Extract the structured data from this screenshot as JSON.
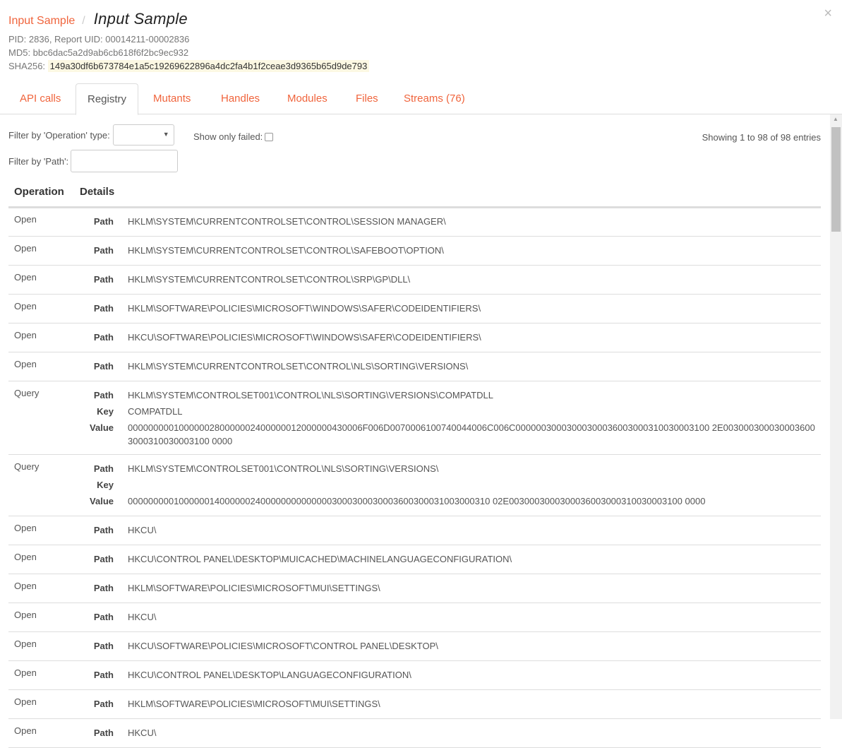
{
  "header": {
    "breadcrumb_link": "Input Sample",
    "breadcrumb_separator": "/",
    "title": "Input Sample",
    "pid_line": "PID: 2836, Report UID: 00014211-00002836",
    "md5_line": "MD5: bbc6dac5a2d9ab6cb618f6f2bc9ec932",
    "sha256_label": "SHA256:",
    "sha256_value": "149a30df6b673784e1a5c19269622896a4dc2fa4b1f2ceae3d9365b65d9de793",
    "close_icon": "×"
  },
  "tabs": [
    {
      "label": "API calls",
      "active": false
    },
    {
      "label": "Registry",
      "active": true
    },
    {
      "label": "Mutants",
      "active": false
    },
    {
      "label": "Handles",
      "active": false
    },
    {
      "label": "Modules",
      "active": false
    },
    {
      "label": "Files",
      "active": false
    },
    {
      "label": "Streams (76)",
      "active": false
    }
  ],
  "filters": {
    "operation_label": "Filter by 'Operation' type:",
    "operation_value": "",
    "failed_label": "Show only failed:",
    "failed_checked": false,
    "path_label": "Filter by 'Path':",
    "path_value": "",
    "showing": "Showing 1 to 98 of 98 entries"
  },
  "table": {
    "columns": [
      "Operation",
      "Details"
    ],
    "rows": [
      {
        "op": "Open",
        "details": [
          {
            "k": "Path",
            "v": "HKLM\\SYSTEM\\CURRENTCONTROLSET\\CONTROL\\SESSION MANAGER\\"
          }
        ]
      },
      {
        "op": "Open",
        "details": [
          {
            "k": "Path",
            "v": "HKLM\\SYSTEM\\CURRENTCONTROLSET\\CONTROL\\SAFEBOOT\\OPTION\\"
          }
        ]
      },
      {
        "op": "Open",
        "details": [
          {
            "k": "Path",
            "v": "HKLM\\SYSTEM\\CURRENTCONTROLSET\\CONTROL\\SRP\\GP\\DLL\\"
          }
        ]
      },
      {
        "op": "Open",
        "details": [
          {
            "k": "Path",
            "v": "HKLM\\SOFTWARE\\POLICIES\\MICROSOFT\\WINDOWS\\SAFER\\CODEIDENTIFIERS\\"
          }
        ]
      },
      {
        "op": "Open",
        "details": [
          {
            "k": "Path",
            "v": "HKCU\\SOFTWARE\\POLICIES\\MICROSOFT\\WINDOWS\\SAFER\\CODEIDENTIFIERS\\"
          }
        ]
      },
      {
        "op": "Open",
        "details": [
          {
            "k": "Path",
            "v": "HKLM\\SYSTEM\\CURRENTCONTROLSET\\CONTROL\\NLS\\SORTING\\VERSIONS\\"
          }
        ]
      },
      {
        "op": "Query",
        "details": [
          {
            "k": "Path",
            "v": "HKLM\\SYSTEM\\CONTROLSET001\\CONTROL\\NLS\\SORTING\\VERSIONS\\COMPATDLL"
          },
          {
            "k": "Key",
            "v": "COMPATDLL"
          },
          {
            "k": "Value",
            "v": "0000000001000000280000002400000012000000430006F006D0070006100740044006C006C00000030003000300036003000310030003100 2E0030003000300036003000310030003100 0000"
          }
        ]
      },
      {
        "op": "Query",
        "details": [
          {
            "k": "Path",
            "v": "HKLM\\SYSTEM\\CONTROLSET001\\CONTROL\\NLS\\SORTING\\VERSIONS\\"
          },
          {
            "k": "Key",
            "v": ""
          },
          {
            "k": "Value",
            "v": "00000000010000001400000024000000000000003000300030003600300031003000310 02E0030003000300036003000310030003100 0000"
          }
        ]
      },
      {
        "op": "Open",
        "details": [
          {
            "k": "Path",
            "v": "HKCU\\"
          }
        ]
      },
      {
        "op": "Open",
        "details": [
          {
            "k": "Path",
            "v": "HKCU\\CONTROL PANEL\\DESKTOP\\MUICACHED\\MACHINELANGUAGECONFIGURATION\\"
          }
        ]
      },
      {
        "op": "Open",
        "details": [
          {
            "k": "Path",
            "v": "HKLM\\SOFTWARE\\POLICIES\\MICROSOFT\\MUI\\SETTINGS\\"
          }
        ]
      },
      {
        "op": "Open",
        "details": [
          {
            "k": "Path",
            "v": "HKCU\\"
          }
        ]
      },
      {
        "op": "Open",
        "details": [
          {
            "k": "Path",
            "v": "HKCU\\SOFTWARE\\POLICIES\\MICROSOFT\\CONTROL PANEL\\DESKTOP\\"
          }
        ]
      },
      {
        "op": "Open",
        "details": [
          {
            "k": "Path",
            "v": "HKCU\\CONTROL PANEL\\DESKTOP\\LANGUAGECONFIGURATION\\"
          }
        ]
      },
      {
        "op": "Open",
        "details": [
          {
            "k": "Path",
            "v": "HKLM\\SOFTWARE\\POLICIES\\MICROSOFT\\MUI\\SETTINGS\\"
          }
        ]
      },
      {
        "op": "Open",
        "details": [
          {
            "k": "Path",
            "v": "HKCU\\"
          }
        ]
      }
    ]
  },
  "colors": {
    "accent": "#f0643c",
    "hash_highlight": "#fcf8e3"
  }
}
